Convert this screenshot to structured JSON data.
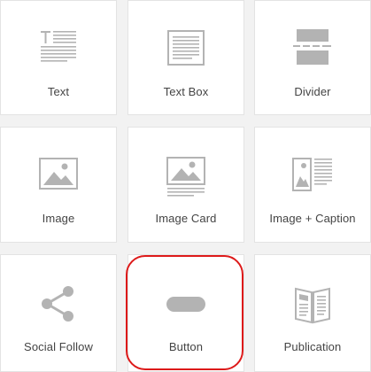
{
  "blocks": [
    {
      "label": "Text",
      "icon": "text-block-icon"
    },
    {
      "label": "Text Box",
      "icon": "text-box-icon"
    },
    {
      "label": "Divider",
      "icon": "divider-icon"
    },
    {
      "label": "Image",
      "icon": "image-icon"
    },
    {
      "label": "Image Card",
      "icon": "image-card-icon"
    },
    {
      "label": "Image + Caption",
      "icon": "image-caption-icon"
    },
    {
      "label": "Social Follow",
      "icon": "share-icon"
    },
    {
      "label": "Button",
      "icon": "button-icon"
    },
    {
      "label": "Publication",
      "icon": "publication-icon"
    }
  ],
  "selected_block": "Button",
  "colors": {
    "icon": "#b3b3b3",
    "label": "#444444",
    "highlight": "#dd1a1a",
    "tile_background": "#ffffff",
    "page_background": "#f2f2f2"
  }
}
